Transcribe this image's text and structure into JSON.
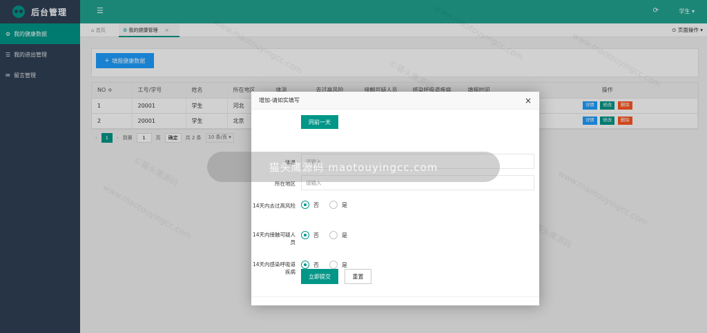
{
  "app": {
    "title": "后台管理"
  },
  "sidebar": {
    "items": [
      {
        "label": "我的健康数据",
        "icon": "gears-icon",
        "active": true
      },
      {
        "label": "我的进出管理",
        "icon": "list-icon",
        "active": false
      },
      {
        "label": "留言管理",
        "icon": "comment-icon",
        "active": false
      }
    ]
  },
  "header": {
    "user": "学生 ▾"
  },
  "tabs": [
    {
      "label": "首页",
      "icon": "home-icon"
    },
    {
      "label": "我的健康管理",
      "icon": "gears-icon",
      "close": "×"
    }
  ],
  "page_ops": "页面操作 ▾",
  "toolbar": {
    "add_label": "填报健康数据"
  },
  "table": {
    "columns": [
      "NO ≑",
      "工号/学号",
      "姓名",
      "所在地区",
      "体温",
      "去过高风险",
      "接触可疑人员",
      "感染呼吸道疾病",
      "填报时间",
      "操作"
    ],
    "rows": [
      {
        "no": "1",
        "id": "20001",
        "name": "学生",
        "region": "河北"
      },
      {
        "no": "2",
        "id": "20001",
        "name": "学生",
        "region": "北京"
      }
    ],
    "actions": {
      "detail": "详情",
      "edit": "修改",
      "delete": "删除"
    }
  },
  "pager": {
    "current": "1",
    "goto_label": "到第",
    "page_value": "1",
    "page_unit": "页",
    "confirm": "确定",
    "total": "共 2 条",
    "per_page": "10 条/页"
  },
  "modal": {
    "title": "增加-请如实填写",
    "close": "×",
    "sync_button": "同前一天",
    "fields": {
      "temperature": {
        "label": "体温",
        "placeholder": "请输入"
      },
      "region": {
        "label": "所在地区",
        "placeholder": "请输入"
      }
    },
    "radios": [
      {
        "label": "14天内去过高风险",
        "no": "否",
        "yes": "是",
        "selected": "否"
      },
      {
        "label": "14天内接触可疑人员",
        "no": "否",
        "yes": "是",
        "selected": "否"
      },
      {
        "label": "14天内感染呼吸道疾病",
        "no": "否",
        "yes": "是",
        "selected": "否"
      }
    ],
    "submit": "立即提交",
    "reset": "重置"
  },
  "watermark": {
    "band": "猫头鹰源码 maotouyingcc.com",
    "url": "www.maotouyingcc.com",
    "brand": "©猫头鹰源码"
  },
  "colors": {
    "primary": "#009688",
    "header": "#23a491",
    "sidebar": "#2f4056",
    "blue": "#1e9fff",
    "danger": "#ff5722"
  }
}
